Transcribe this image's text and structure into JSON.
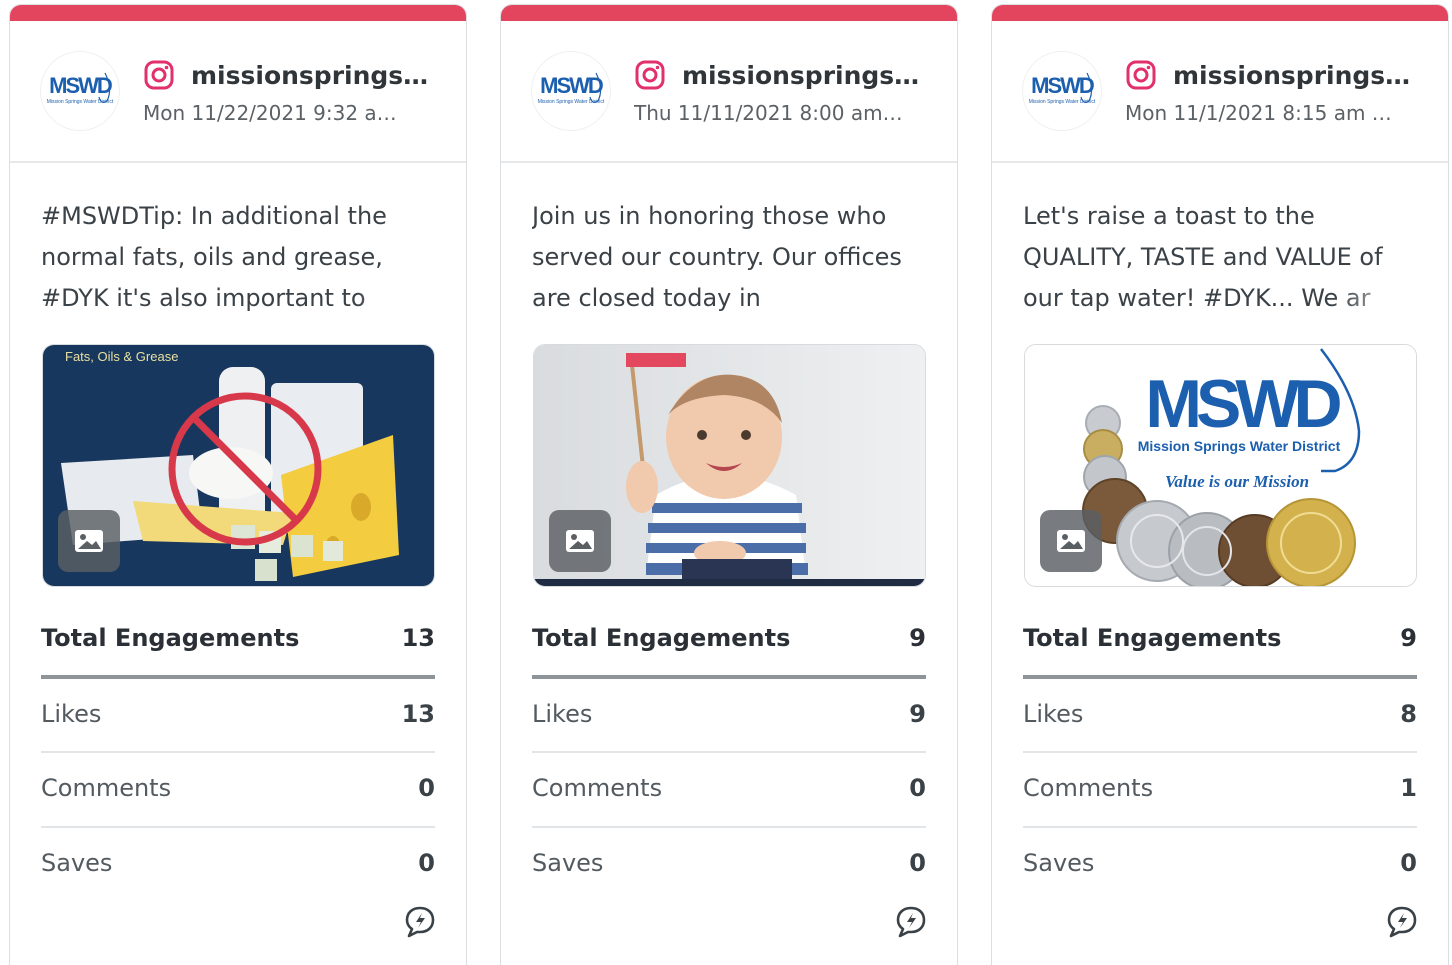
{
  "cards": [
    {
      "account": "missionsprings…",
      "date": "Mon 11/22/2021 9:32 a…",
      "caption": "#MSWDTip: In additional the normal fats, oils and grease, #DYK it's also important to",
      "image_text": "Fats, Oils & Grease",
      "avatar_text": "MSWD",
      "avatar_sub": "Mission Springs Water District",
      "metrics": {
        "total_label": "Total Engagements",
        "total": "13",
        "likes_label": "Likes",
        "likes": "13",
        "comments_label": "Comments",
        "comments": "0",
        "saves_label": "Saves",
        "saves": "0"
      }
    },
    {
      "account": "missionsprings…",
      "date": "Thu 11/11/2021 8:00 am…",
      "caption": "Join us in honoring those who served our country. Our offices are closed today in",
      "avatar_text": "MSWD",
      "avatar_sub": "Mission Springs Water District",
      "metrics": {
        "total_label": "Total Engagements",
        "total": "9",
        "likes_label": "Likes",
        "likes": "9",
        "comments_label": "Comments",
        "comments": "0",
        "saves_label": "Saves",
        "saves": "0"
      }
    },
    {
      "account": "missionsprings…",
      "date": "Mon 11/1/2021 8:15 am …",
      "caption": "Let's raise a toast to the QUALITY, TASTE and VALUE of our tap water! #DYK... We ar",
      "image_logo": "MSWD",
      "image_sub": "Mission Springs Water District",
      "image_tagline": "Value is our Mission",
      "avatar_text": "MSWD",
      "avatar_sub": "Mission Springs Water District",
      "metrics": {
        "total_label": "Total Engagements",
        "total": "9",
        "likes_label": "Likes",
        "likes": "8",
        "comments_label": "Comments",
        "comments": "1",
        "saves_label": "Saves",
        "saves": "0"
      }
    }
  ],
  "colors": {
    "accent": "#e3455e",
    "instagram": "#e1306c",
    "logo_blue": "#1b5fae"
  },
  "icons": {
    "platform": "instagram-icon",
    "media": "image-icon",
    "boost": "boost-post-icon"
  }
}
